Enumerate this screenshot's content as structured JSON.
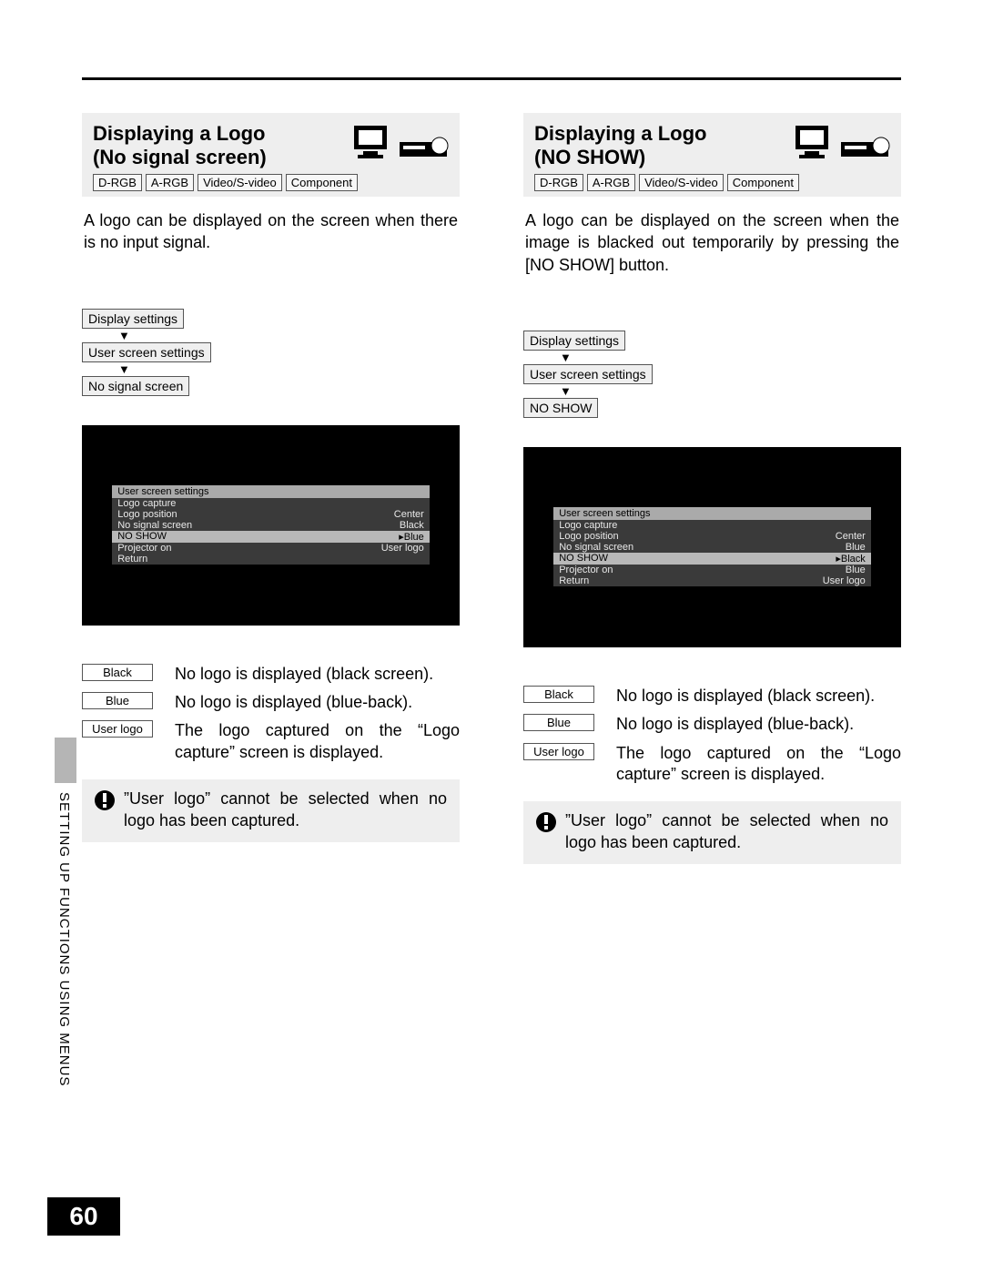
{
  "page_number": "60",
  "side_label": "SETTING UP FUNCTIONS USING MENUS",
  "inputs": [
    "D-RGB",
    "A-RGB",
    "Video/S-video",
    "Component"
  ],
  "left": {
    "title_l1": "Displaying a Logo",
    "title_l2": "(No signal screen)",
    "intro": "A logo can be displayed on the screen when there is no input signal.",
    "path": [
      "Display settings",
      "User screen settings",
      "No signal screen"
    ],
    "osd": {
      "header": "User screen settings",
      "rows": [
        {
          "label": "Logo capture",
          "value": "",
          "sel": false
        },
        {
          "label": "Logo position",
          "value": "Center",
          "sel": false
        },
        {
          "label": "No signal screen",
          "value": "Black",
          "sel": false
        },
        {
          "label": "NO SHOW",
          "value": "▸Blue",
          "sel": true
        },
        {
          "label": "Projector on",
          "value": "User logo",
          "sel": false
        },
        {
          "label": "Return",
          "value": "",
          "sel": false
        }
      ]
    },
    "options": [
      {
        "label": "Black",
        "desc": "No logo is displayed (black screen)."
      },
      {
        "label": "Blue",
        "desc": "No logo is displayed (blue-back)."
      },
      {
        "label": "User logo",
        "desc": "The logo captured on the “Logo capture” screen is displayed."
      }
    ],
    "note": "”User logo” cannot be selected when no logo has been captured."
  },
  "right": {
    "title_l1": "Displaying a Logo",
    "title_l2": "(NO SHOW)",
    "intro": "A logo can be displayed on the screen when the image is blacked out temporarily by pressing the [NO SHOW] button.",
    "path": [
      "Display settings",
      "User screen settings",
      "NO SHOW"
    ],
    "osd": {
      "header": "User screen settings",
      "rows": [
        {
          "label": "Logo capture",
          "value": "",
          "sel": false
        },
        {
          "label": "Logo position",
          "value": "Center",
          "sel": false
        },
        {
          "label": "No signal screen",
          "value": "Blue",
          "sel": false
        },
        {
          "label": "NO SHOW",
          "value": "▸Black",
          "sel": true
        },
        {
          "label": "Projector on",
          "value": "Blue",
          "sel": false
        },
        {
          "label": "Return",
          "value": "User logo",
          "sel": false
        }
      ]
    },
    "options": [
      {
        "label": "Black",
        "desc": "No logo is displayed (black screen)."
      },
      {
        "label": "Blue",
        "desc": "No logo is displayed (blue-back)."
      },
      {
        "label": "User logo",
        "desc": "The logo captured on the “Logo capture” screen is displayed."
      }
    ],
    "note": "”User logo” cannot be selected when no logo has been captured."
  }
}
